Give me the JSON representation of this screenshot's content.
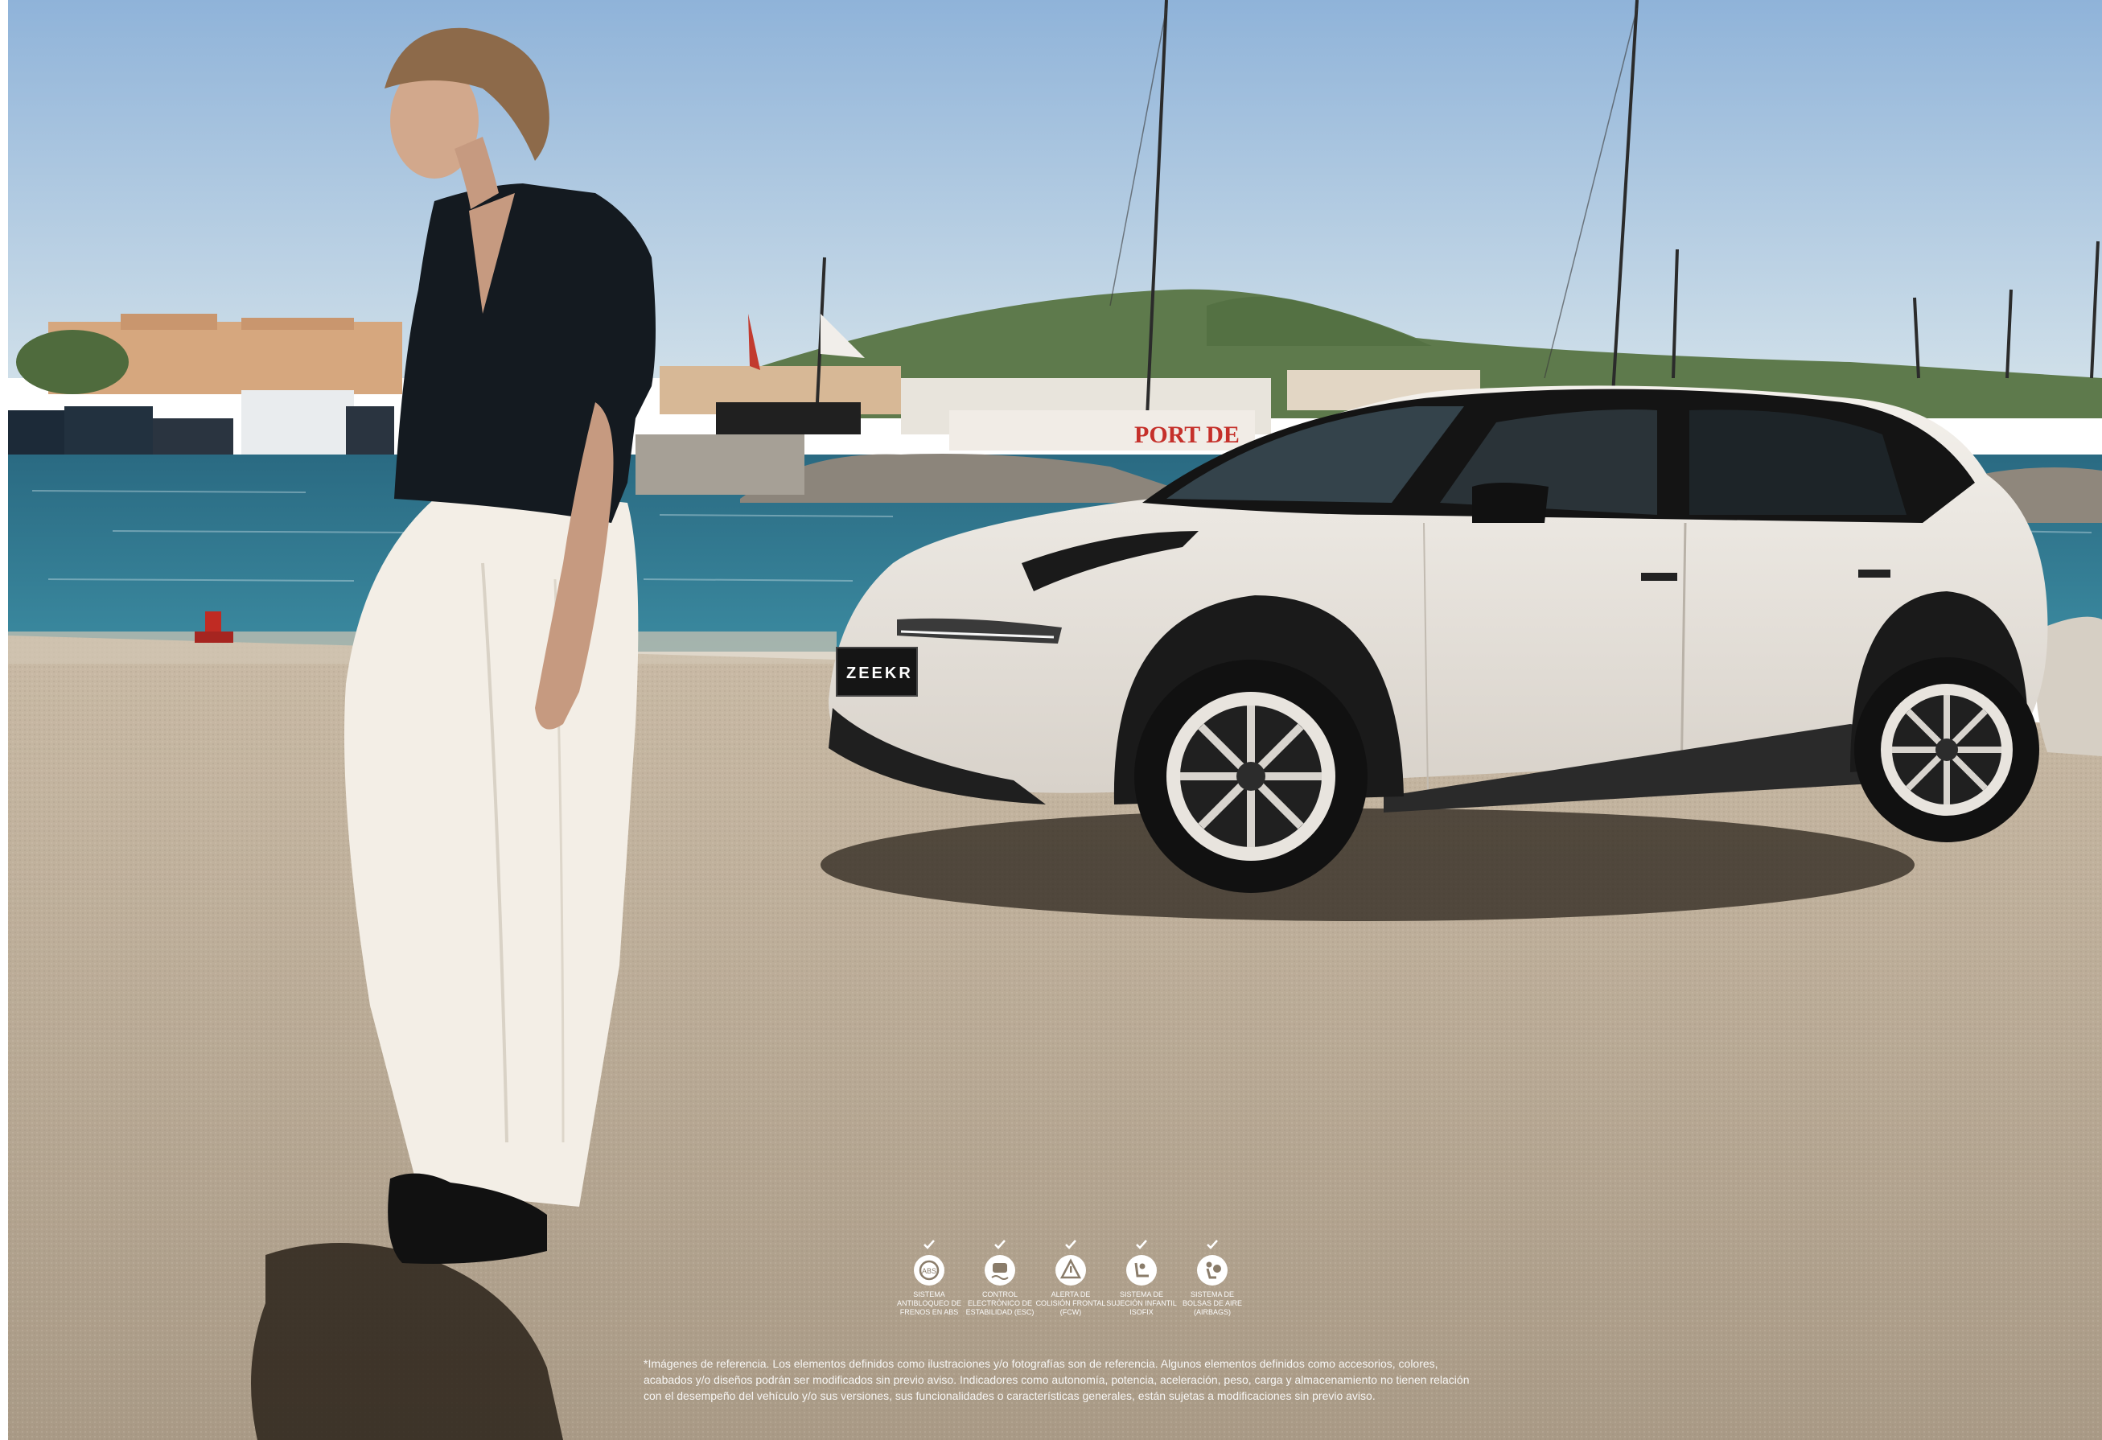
{
  "scene": {
    "banner_text": "PORT DE",
    "car_badge": "ZEEKR"
  },
  "features": [
    {
      "icon": "abs-brake-icon",
      "label": "SISTEMA ANTIBLOQUEO DE FRENOS EN ABS"
    },
    {
      "icon": "stability-control-icon",
      "label": "CONTROL ELECTRÓNICO DE ESTABILIDAD (ESC)"
    },
    {
      "icon": "collision-alert-icon",
      "label": "ALERTA DE COLISIÓN FRONTAL (FCW)"
    },
    {
      "icon": "child-seat-icon",
      "label": "SISTEMA DE SUJECIÓN INFANTIL ISOFIX"
    },
    {
      "icon": "airbag-icon",
      "label": "SISTEMA DE BOLSAS DE AIRE (AIRBAGS)"
    }
  ],
  "disclaimer": "*Imágenes de referencia. Los elementos definidos como ilustraciones y/o fotografías son de referencia. Algunos elementos definidos como accesorios, colores, acabados y/o diseños podrán ser modificados sin previo aviso. Indicadores como autonomía, potencia, aceleración, peso, carga y almacenamiento no tienen relación con el desempeño del vehículo y/o sus versiones, sus funcionalidades o características generales, están sujetas a modificaciones sin previo aviso.",
  "colors": {
    "sky_top": "#8fb3d9",
    "sky_bottom": "#c9dbe8",
    "sea": "#2f6f86",
    "pavement": "#b9a994",
    "car_body": "#ece7e0",
    "car_roof": "#141414",
    "shirt": "#14181d",
    "trousers": "#f2ece3"
  }
}
